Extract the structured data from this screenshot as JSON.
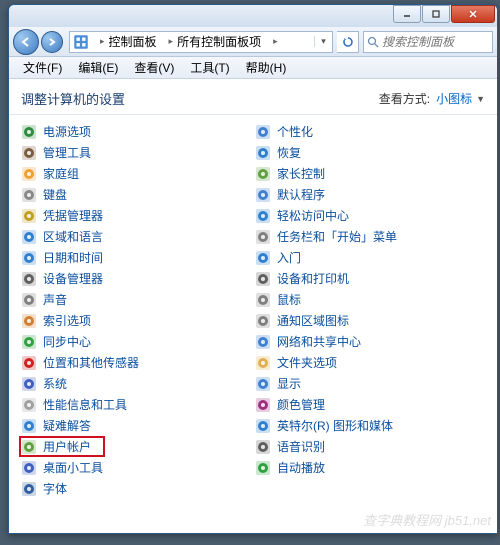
{
  "window": {
    "titlebar_icon_alt": "control-panel"
  },
  "nav": {
    "crumb1": "控制面板",
    "crumb2": "所有控制面板项"
  },
  "search": {
    "placeholder": "搜索控制面板"
  },
  "menu": {
    "file": "文件(F)",
    "edit": "编辑(E)",
    "view": "查看(V)",
    "tools": "工具(T)",
    "help": "帮助(H)"
  },
  "header": {
    "title": "调整计算机的设置",
    "view_label": "查看方式:",
    "view_value": "小图标"
  },
  "left_items": [
    {
      "icon": "power",
      "label": "电源选项"
    },
    {
      "icon": "tools",
      "label": "管理工具"
    },
    {
      "icon": "home",
      "label": "家庭组"
    },
    {
      "icon": "keyboard",
      "label": "键盘"
    },
    {
      "icon": "cred",
      "label": "凭据管理器"
    },
    {
      "icon": "globe",
      "label": "区域和语言"
    },
    {
      "icon": "clock",
      "label": "日期和时间"
    },
    {
      "icon": "device",
      "label": "设备管理器"
    },
    {
      "icon": "sound",
      "label": "声音"
    },
    {
      "icon": "index",
      "label": "索引选项"
    },
    {
      "icon": "sync",
      "label": "同步中心"
    },
    {
      "icon": "sensor",
      "label": "位置和其他传感器"
    },
    {
      "icon": "system",
      "label": "系统"
    },
    {
      "icon": "perf",
      "label": "性能信息和工具"
    },
    {
      "icon": "trouble",
      "label": "疑难解答"
    },
    {
      "icon": "user",
      "label": "用户帐户",
      "hl": true
    },
    {
      "icon": "gadget",
      "label": "桌面小工具"
    },
    {
      "icon": "font",
      "label": "字体"
    }
  ],
  "right_items": [
    {
      "icon": "personal",
      "label": "个性化"
    },
    {
      "icon": "recovery",
      "label": "恢复"
    },
    {
      "icon": "parental",
      "label": "家长控制"
    },
    {
      "icon": "default",
      "label": "默认程序"
    },
    {
      "icon": "ease",
      "label": "轻松访问中心"
    },
    {
      "icon": "taskbar",
      "label": "任务栏和「开始」菜单"
    },
    {
      "icon": "start",
      "label": "入门"
    },
    {
      "icon": "printer",
      "label": "设备和打印机"
    },
    {
      "icon": "mouse",
      "label": "鼠标"
    },
    {
      "icon": "tray",
      "label": "通知区域图标"
    },
    {
      "icon": "network",
      "label": "网络和共享中心"
    },
    {
      "icon": "folder",
      "label": "文件夹选项"
    },
    {
      "icon": "display",
      "label": "显示"
    },
    {
      "icon": "color",
      "label": "颜色管理"
    },
    {
      "icon": "intel",
      "label": "英特尔(R) 图形和媒体"
    },
    {
      "icon": "speech",
      "label": "语音识别"
    },
    {
      "icon": "autoplay",
      "label": "自动播放"
    }
  ],
  "watermark": "查字典教程网  jb51.net",
  "icons": {
    "power": "#2e8b3e",
    "tools": "#7a5c3e",
    "home": "#f0a030",
    "keyboard": "#888",
    "cred": "#c0a020",
    "globe": "#3080d0",
    "clock": "#3080d0",
    "device": "#606060",
    "sound": "#808080",
    "index": "#d08030",
    "sync": "#30a040",
    "sensor": "#d02020",
    "system": "#4060c0",
    "perf": "#a0a0a0",
    "trouble": "#3080d0",
    "user": "#60a040",
    "gadget": "#4060c0",
    "font": "#3060a0",
    "personal": "#4080d0",
    "recovery": "#3080d0",
    "parental": "#60a040",
    "default": "#4080d0",
    "ease": "#3080d0",
    "taskbar": "#808080",
    "start": "#3080d0",
    "printer": "#606060",
    "mouse": "#808080",
    "tray": "#808080",
    "network": "#4080d0",
    "folder": "#e0b050",
    "display": "#4080d0",
    "color": "#a03080",
    "intel": "#3080d0",
    "speech": "#606060",
    "autoplay": "#30a040"
  }
}
